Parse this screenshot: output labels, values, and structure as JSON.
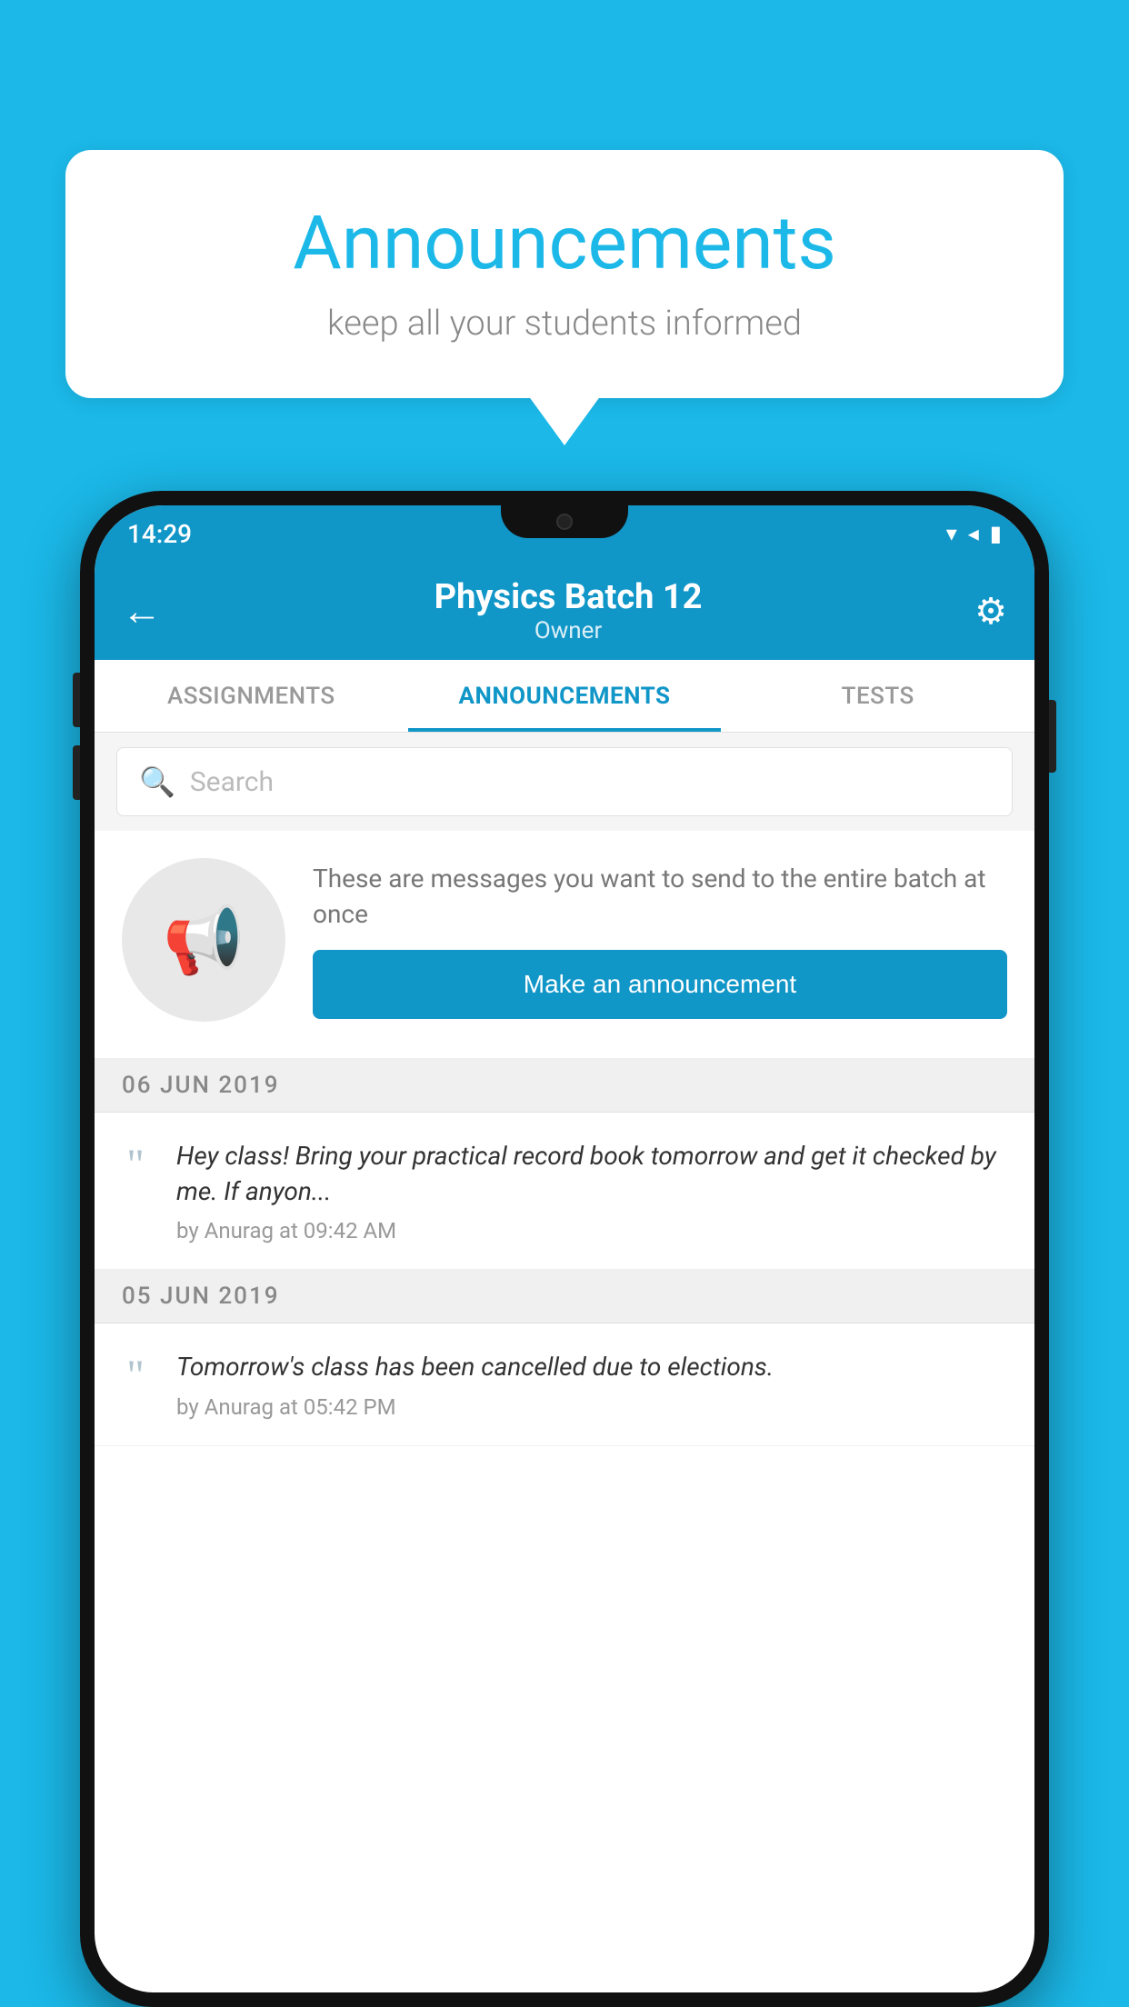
{
  "page": {
    "background_color": "#1BB8E8"
  },
  "speech_bubble": {
    "title": "Announcements",
    "subtitle": "keep all your students informed"
  },
  "phone": {
    "status_bar": {
      "time": "14:29"
    },
    "app_bar": {
      "title": "Physics Batch 12",
      "subtitle": "Owner",
      "back_label": "←",
      "settings_label": "⚙"
    },
    "tabs": [
      {
        "label": "ASSIGNMENTS",
        "active": false
      },
      {
        "label": "ANNOUNCEMENTS",
        "active": true
      },
      {
        "label": "TESTS",
        "active": false
      }
    ],
    "search": {
      "placeholder": "Search"
    },
    "announcement_empty": {
      "description": "These are messages you want to send to the entire batch at once",
      "button_label": "Make an announcement"
    },
    "date_groups": [
      {
        "date": "06  JUN  2019",
        "items": [
          {
            "message": "Hey class! Bring your practical record book tomorrow and get it checked by me. If anyon...",
            "meta": "by Anurag at 09:42 AM"
          }
        ]
      },
      {
        "date": "05  JUN  2019",
        "items": [
          {
            "message": "Tomorrow's class has been cancelled due to elections.",
            "meta": "by Anurag at 05:42 PM"
          }
        ]
      }
    ]
  }
}
